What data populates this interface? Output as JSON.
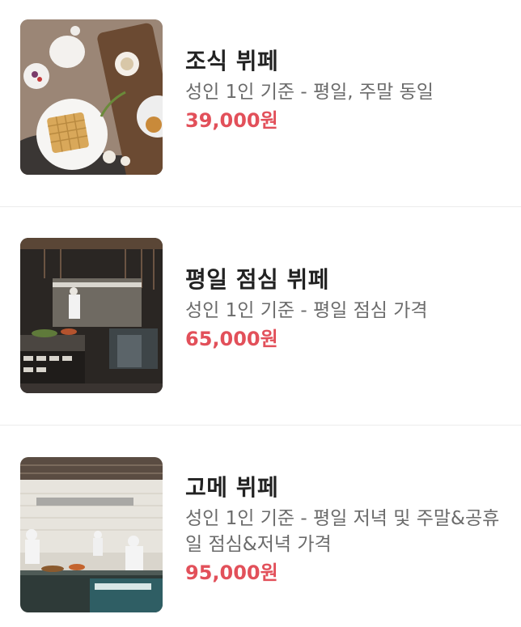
{
  "items": [
    {
      "title": "조식 뷔페",
      "description": "성인 1인 기준 - 평일, 주말 동일",
      "price": "39,000원",
      "image": "breakfast-waffle-photo"
    },
    {
      "title": "평일 점심 뷔페",
      "description": "성인 1인 기준 - 평일 점심 가격",
      "price": "65,000원",
      "image": "buffet-restaurant-interior-photo"
    },
    {
      "title": "고메 뷔페",
      "description": "성인 1인 기준 - 평일 저녁 및 주말&공휴일 점심&저녁 가격",
      "price": "95,000원",
      "image": "chefs-kitchen-photo"
    }
  ],
  "colors": {
    "price": "#e2505a",
    "title": "#222222",
    "description": "#6b6b6b",
    "divider": "#ececec"
  }
}
